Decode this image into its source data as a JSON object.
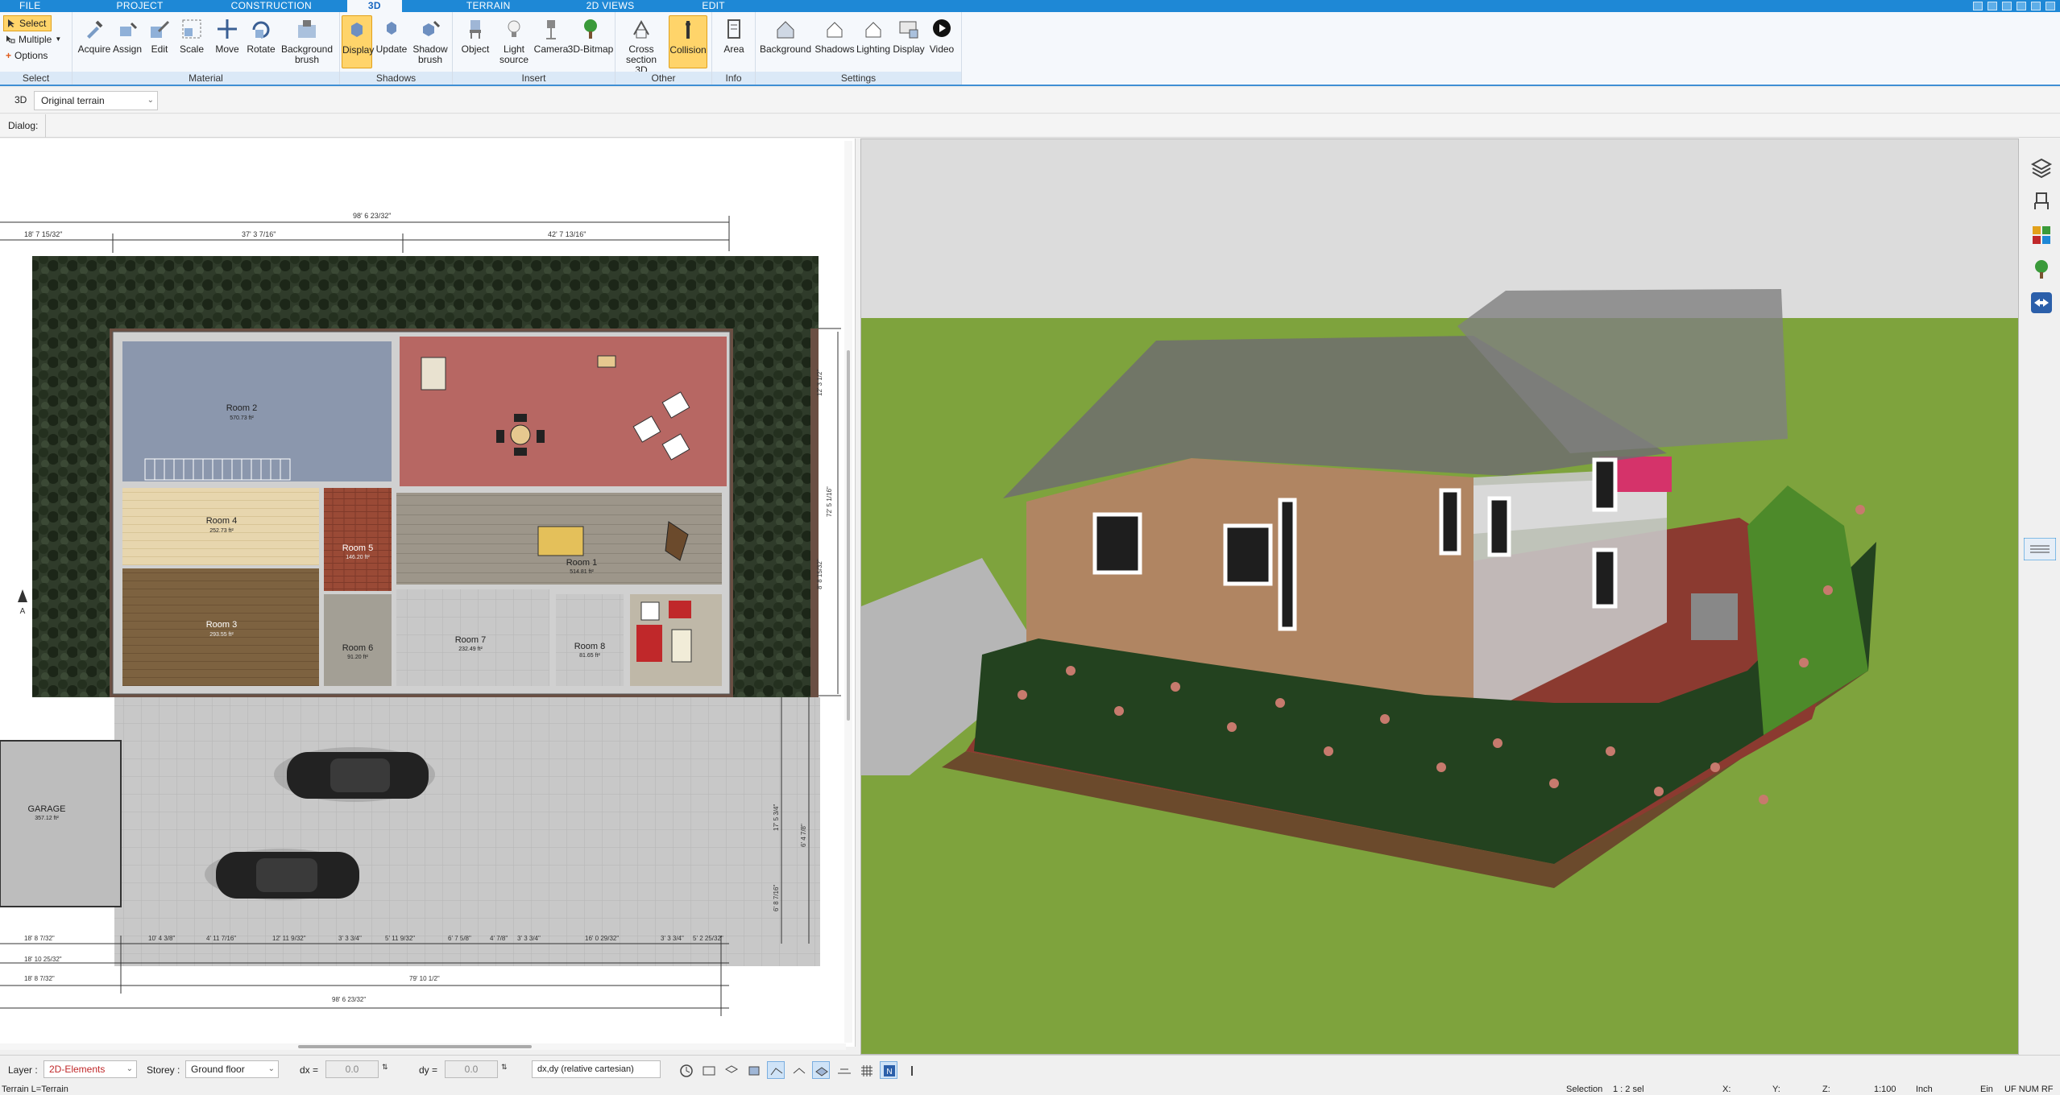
{
  "menu_tabs": [
    "FILE",
    "PROJECT",
    "CONSTRUCTION",
    "3D",
    "TERRAIN",
    "2D VIEWS",
    "EDIT"
  ],
  "select_group": {
    "select": "Select",
    "multiple": "Multiple",
    "options": "Options",
    "label": "Select"
  },
  "ribbon": {
    "material": {
      "label": "Material",
      "buttons": [
        "Acquire",
        "Assign",
        "Edit",
        "Scale",
        "Move",
        "Rotate",
        "Background brush"
      ]
    },
    "shadows": {
      "label": "Shadows",
      "buttons": [
        "Display",
        "Update",
        "Shadow brush"
      ]
    },
    "insert": {
      "label": "Insert",
      "buttons": [
        "Object",
        "Light source",
        "Camera",
        "3D-Bitmap"
      ]
    },
    "other": {
      "label": "Other",
      "buttons": [
        "Cross section 3D",
        "Collision"
      ]
    },
    "info": {
      "label": "Info",
      "buttons": [
        "Area"
      ]
    },
    "settings": {
      "label": "Settings",
      "buttons": [
        "Background",
        "Shadows",
        "Lighting",
        "Display",
        "Video"
      ]
    }
  },
  "toolbar2": {
    "mode": "3D",
    "terrain_select": "Original terrain"
  },
  "dialog_label": "Dialog:",
  "plan": {
    "rooms": [
      {
        "name": "Room 2",
        "area": "570.73 ft²"
      },
      {
        "name": "Room 4",
        "area": "252.73 ft²"
      },
      {
        "name": "Room 3",
        "area": "293.55 ft²"
      },
      {
        "name": "Room 1",
        "area": "514.81 ft²"
      },
      {
        "name": "Room 5",
        "area": "146.20 ft²"
      },
      {
        "name": "Room 6",
        "area": "91.20 ft²"
      },
      {
        "name": "Room 7",
        "area": "232.49 ft²"
      },
      {
        "name": "Room 8",
        "area": "81.65 ft²"
      },
      {
        "name": "GARAGE",
        "area": "357.12 ft²"
      }
    ],
    "dims_top": [
      "98' 6 23/32\"",
      "18' 7 15/32\"",
      "37' 3 7/16\"",
      "42' 7 13/16\""
    ],
    "dims_bottom": [
      "18' 8 7/32\"",
      "10' 4 3/8\"",
      "4' 11 7/16\"",
      "12' 11 9/32\"",
      "3' 3 3/4\"",
      "5' 11 9/32\"",
      "6' 7 5/8\"",
      "4' 7/8\"",
      "3' 3 3/4\"",
      "16' 0 29/32\"",
      "3' 3 3/4\"",
      "5' 2 25/32\"",
      "18' 10 25/32\"",
      "79' 10 1/2\"",
      "18' 8 7/32\"",
      "98' 6 23/32\""
    ],
    "dims_right": [
      "72' 5 1/16\"",
      "12' 3 1/2\"",
      "8' 8 15/32\"",
      "17' 5 3/4\"",
      "6' 4 7/8\"",
      "6' 8 7/16\""
    ]
  },
  "statusbar": {
    "layer_label": "Layer :",
    "layer_value": "2D-Elements",
    "storey_label": "Storey :",
    "storey_value": "Ground floor",
    "dx_label": "dx =",
    "dx_value": "0.0",
    "dy_label": "dy =",
    "dy_value": "0.0",
    "coord_mode": "dx,dy (relative cartesian)"
  },
  "infobar": {
    "left": "Terrain L=Terrain",
    "selection": "Selection",
    "selcount": "1 : 2 sel",
    "x": "X:",
    "y": "Y:",
    "z": "Z:",
    "scale": "1:100",
    "unit": "Inch",
    "ein": "Ein",
    "flags": "UF NUM RF"
  },
  "colors": {
    "accent": "#1e88d6",
    "ribbon_active": "#ffd46a",
    "grass": "#7ea33d",
    "sky": "#dcdcdc"
  }
}
